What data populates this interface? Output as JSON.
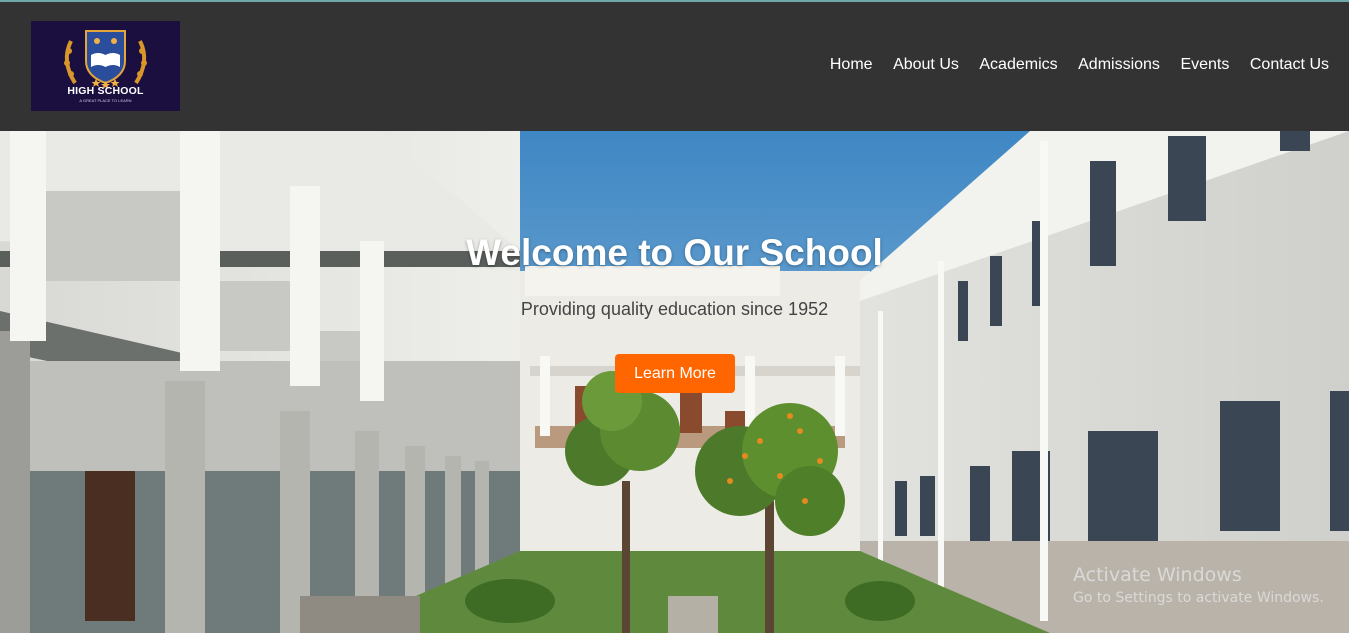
{
  "logo": {
    "name": "HIGH SCHOOL",
    "tagline": "A GREAT PLACE TO LEARN"
  },
  "nav": {
    "items": [
      "Home",
      "About Us",
      "Academics",
      "Admissions",
      "Events",
      "Contact Us"
    ]
  },
  "hero": {
    "title": "Welcome to Our School",
    "subtitle": "Providing quality education since 1952",
    "cta_label": "Learn More"
  },
  "watermark": {
    "line1": "Activate Windows",
    "line2": "Go to Settings to activate Windows."
  },
  "colors": {
    "header_bg": "#333333",
    "accent": "#ff6600",
    "logo_bg": "#1b0f3f"
  }
}
